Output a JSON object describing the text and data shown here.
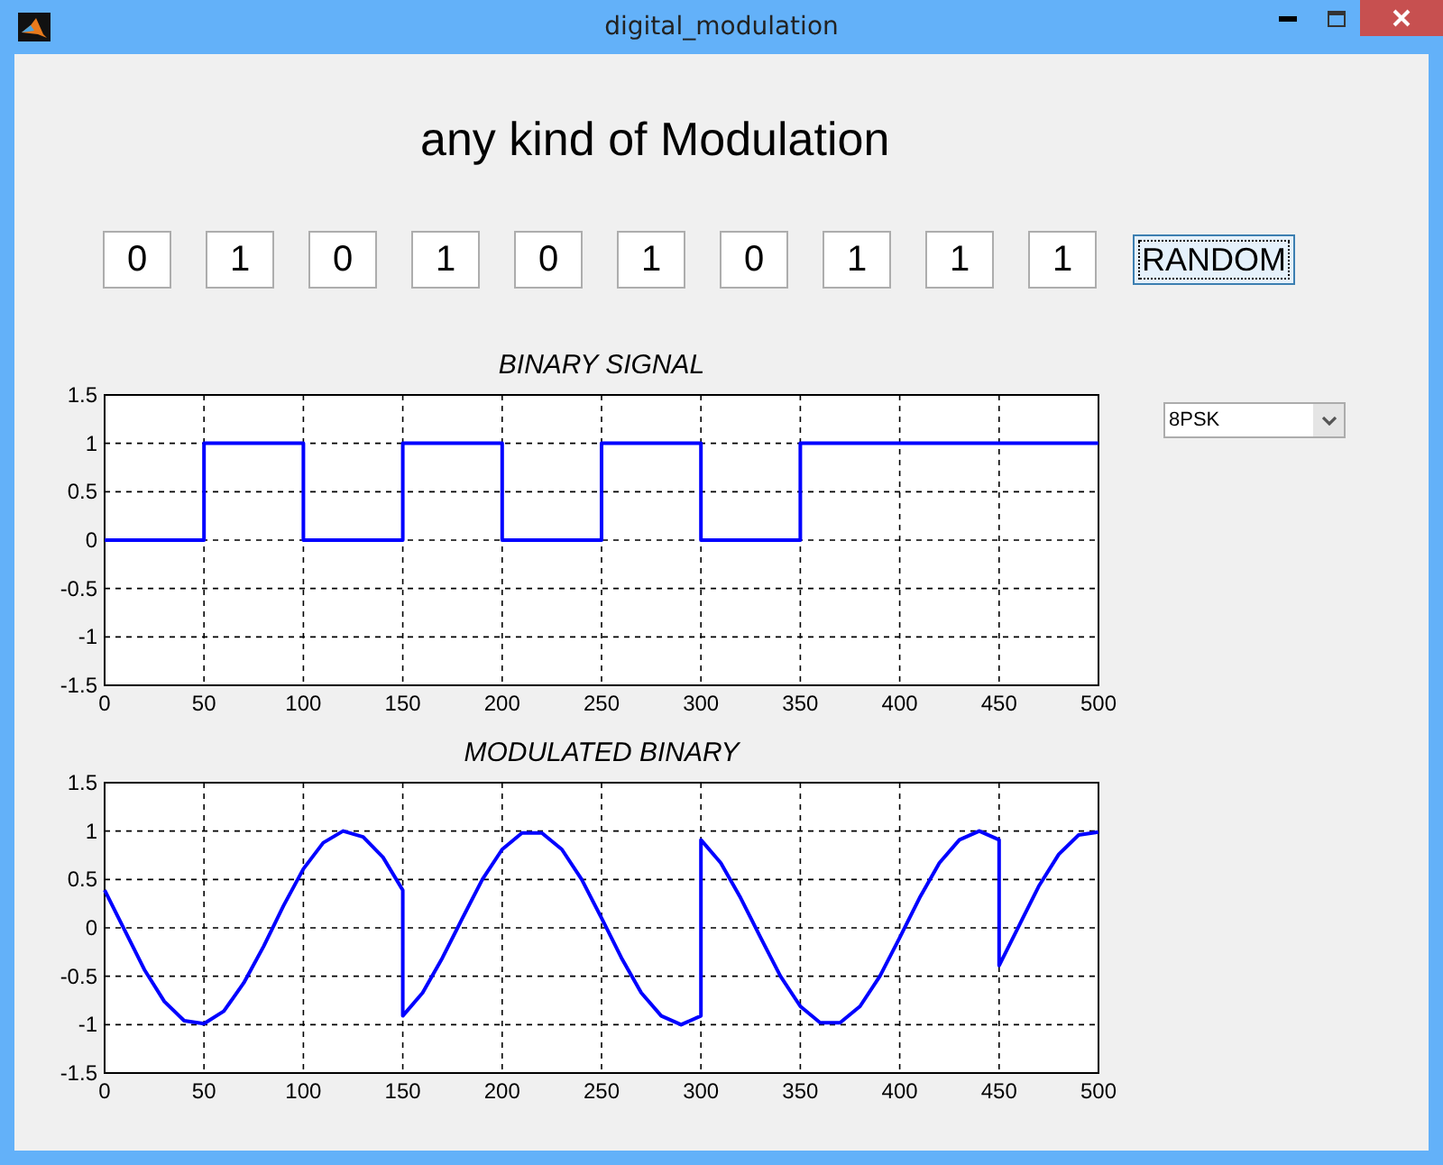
{
  "window": {
    "title": "digital_modulation"
  },
  "heading": "any kind of Modulation",
  "bits": [
    "0",
    "1",
    "0",
    "1",
    "0",
    "1",
    "0",
    "1",
    "1",
    "1"
  ],
  "random_button": "RANDOM",
  "modulation_select": {
    "value": "8PSK"
  },
  "charts": [
    {
      "chart_data": {
        "type": "line",
        "title": "BINARY SIGNAL",
        "x": [
          0,
          50,
          50,
          100,
          100,
          150,
          150,
          200,
          200,
          250,
          250,
          300,
          300,
          350,
          350,
          500
        ],
        "grid": true,
        "series": [
          {
            "color": "#0000ff",
            "values": [
              0,
              0,
              1,
              1,
              0,
              0,
              1,
              1,
              0,
              0,
              1,
              1,
              0,
              0,
              1,
              1
            ]
          }
        ],
        "xlim": [
          0,
          500
        ],
        "ylim": [
          -1.5,
          1.5
        ],
        "xticks": [
          0,
          50,
          100,
          150,
          200,
          250,
          300,
          350,
          400,
          450,
          500
        ],
        "yticks": [
          -1.5,
          -1,
          -0.5,
          0,
          0.5,
          1,
          1.5
        ]
      }
    },
    {
      "chart_data": {
        "type": "line",
        "title": "MODULATED BINARY",
        "x": [
          0,
          10,
          20,
          30,
          40,
          50,
          60,
          70,
          80,
          90,
          100,
          110,
          120,
          130,
          140,
          150,
          150,
          160,
          170,
          180,
          190,
          200,
          210,
          220,
          230,
          240,
          250,
          260,
          270,
          280,
          290,
          300,
          300,
          310,
          320,
          330,
          340,
          350,
          360,
          370,
          380,
          390,
          400,
          410,
          420,
          430,
          440,
          450,
          450,
          460,
          470,
          480,
          490,
          500
        ],
        "grid": true,
        "series": [
          {
            "color": "#0000ff",
            "values": [
              0.39,
              -0.02,
              -0.43,
              -0.76,
              -0.96,
              -0.99,
              -0.86,
              -0.57,
              -0.19,
              0.23,
              0.61,
              0.88,
              1,
              0.94,
              0.73,
              0.39,
              -0.91,
              -0.67,
              -0.31,
              0.1,
              0.5,
              0.81,
              0.98,
              0.98,
              0.81,
              0.5,
              0.1,
              -0.31,
              -0.67,
              -0.91,
              -1,
              -0.91,
              0.91,
              0.67,
              0.31,
              -0.1,
              -0.5,
              -0.81,
              -0.98,
              -0.98,
              -0.81,
              -0.5,
              -0.1,
              0.31,
              0.67,
              0.91,
              1,
              0.91,
              -0.39,
              0.02,
              0.43,
              0.76,
              0.96,
              0.99
            ]
          }
        ],
        "xlim": [
          0,
          500
        ],
        "ylim": [
          -1.5,
          1.5
        ],
        "xticks": [
          0,
          50,
          100,
          150,
          200,
          250,
          300,
          350,
          400,
          450,
          500
        ],
        "yticks": [
          -1.5,
          -1,
          -0.5,
          0,
          0.5,
          1,
          1.5
        ]
      }
    }
  ]
}
